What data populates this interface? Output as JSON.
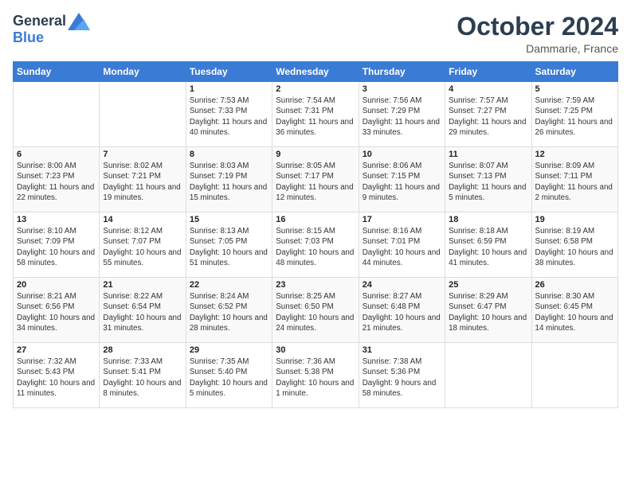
{
  "header": {
    "logo_line1": "General",
    "logo_line2": "Blue",
    "month": "October 2024",
    "location": "Dammarie, France"
  },
  "weekdays": [
    "Sunday",
    "Monday",
    "Tuesday",
    "Wednesday",
    "Thursday",
    "Friday",
    "Saturday"
  ],
  "weeks": [
    [
      {
        "day": "",
        "info": ""
      },
      {
        "day": "",
        "info": ""
      },
      {
        "day": "1",
        "info": "Sunrise: 7:53 AM\nSunset: 7:33 PM\nDaylight: 11 hours and 40 minutes."
      },
      {
        "day": "2",
        "info": "Sunrise: 7:54 AM\nSunset: 7:31 PM\nDaylight: 11 hours and 36 minutes."
      },
      {
        "day": "3",
        "info": "Sunrise: 7:56 AM\nSunset: 7:29 PM\nDaylight: 11 hours and 33 minutes."
      },
      {
        "day": "4",
        "info": "Sunrise: 7:57 AM\nSunset: 7:27 PM\nDaylight: 11 hours and 29 minutes."
      },
      {
        "day": "5",
        "info": "Sunrise: 7:59 AM\nSunset: 7:25 PM\nDaylight: 11 hours and 26 minutes."
      }
    ],
    [
      {
        "day": "6",
        "info": "Sunrise: 8:00 AM\nSunset: 7:23 PM\nDaylight: 11 hours and 22 minutes."
      },
      {
        "day": "7",
        "info": "Sunrise: 8:02 AM\nSunset: 7:21 PM\nDaylight: 11 hours and 19 minutes."
      },
      {
        "day": "8",
        "info": "Sunrise: 8:03 AM\nSunset: 7:19 PM\nDaylight: 11 hours and 15 minutes."
      },
      {
        "day": "9",
        "info": "Sunrise: 8:05 AM\nSunset: 7:17 PM\nDaylight: 11 hours and 12 minutes."
      },
      {
        "day": "10",
        "info": "Sunrise: 8:06 AM\nSunset: 7:15 PM\nDaylight: 11 hours and 9 minutes."
      },
      {
        "day": "11",
        "info": "Sunrise: 8:07 AM\nSunset: 7:13 PM\nDaylight: 11 hours and 5 minutes."
      },
      {
        "day": "12",
        "info": "Sunrise: 8:09 AM\nSunset: 7:11 PM\nDaylight: 11 hours and 2 minutes."
      }
    ],
    [
      {
        "day": "13",
        "info": "Sunrise: 8:10 AM\nSunset: 7:09 PM\nDaylight: 10 hours and 58 minutes."
      },
      {
        "day": "14",
        "info": "Sunrise: 8:12 AM\nSunset: 7:07 PM\nDaylight: 10 hours and 55 minutes."
      },
      {
        "day": "15",
        "info": "Sunrise: 8:13 AM\nSunset: 7:05 PM\nDaylight: 10 hours and 51 minutes."
      },
      {
        "day": "16",
        "info": "Sunrise: 8:15 AM\nSunset: 7:03 PM\nDaylight: 10 hours and 48 minutes."
      },
      {
        "day": "17",
        "info": "Sunrise: 8:16 AM\nSunset: 7:01 PM\nDaylight: 10 hours and 44 minutes."
      },
      {
        "day": "18",
        "info": "Sunrise: 8:18 AM\nSunset: 6:59 PM\nDaylight: 10 hours and 41 minutes."
      },
      {
        "day": "19",
        "info": "Sunrise: 8:19 AM\nSunset: 6:58 PM\nDaylight: 10 hours and 38 minutes."
      }
    ],
    [
      {
        "day": "20",
        "info": "Sunrise: 8:21 AM\nSunset: 6:56 PM\nDaylight: 10 hours and 34 minutes."
      },
      {
        "day": "21",
        "info": "Sunrise: 8:22 AM\nSunset: 6:54 PM\nDaylight: 10 hours and 31 minutes."
      },
      {
        "day": "22",
        "info": "Sunrise: 8:24 AM\nSunset: 6:52 PM\nDaylight: 10 hours and 28 minutes."
      },
      {
        "day": "23",
        "info": "Sunrise: 8:25 AM\nSunset: 6:50 PM\nDaylight: 10 hours and 24 minutes."
      },
      {
        "day": "24",
        "info": "Sunrise: 8:27 AM\nSunset: 6:48 PM\nDaylight: 10 hours and 21 minutes."
      },
      {
        "day": "25",
        "info": "Sunrise: 8:29 AM\nSunset: 6:47 PM\nDaylight: 10 hours and 18 minutes."
      },
      {
        "day": "26",
        "info": "Sunrise: 8:30 AM\nSunset: 6:45 PM\nDaylight: 10 hours and 14 minutes."
      }
    ],
    [
      {
        "day": "27",
        "info": "Sunrise: 7:32 AM\nSunset: 5:43 PM\nDaylight: 10 hours and 11 minutes."
      },
      {
        "day": "28",
        "info": "Sunrise: 7:33 AM\nSunset: 5:41 PM\nDaylight: 10 hours and 8 minutes."
      },
      {
        "day": "29",
        "info": "Sunrise: 7:35 AM\nSunset: 5:40 PM\nDaylight: 10 hours and 5 minutes."
      },
      {
        "day": "30",
        "info": "Sunrise: 7:36 AM\nSunset: 5:38 PM\nDaylight: 10 hours and 1 minute."
      },
      {
        "day": "31",
        "info": "Sunrise: 7:38 AM\nSunset: 5:36 PM\nDaylight: 9 hours and 58 minutes."
      },
      {
        "day": "",
        "info": ""
      },
      {
        "day": "",
        "info": ""
      }
    ]
  ]
}
